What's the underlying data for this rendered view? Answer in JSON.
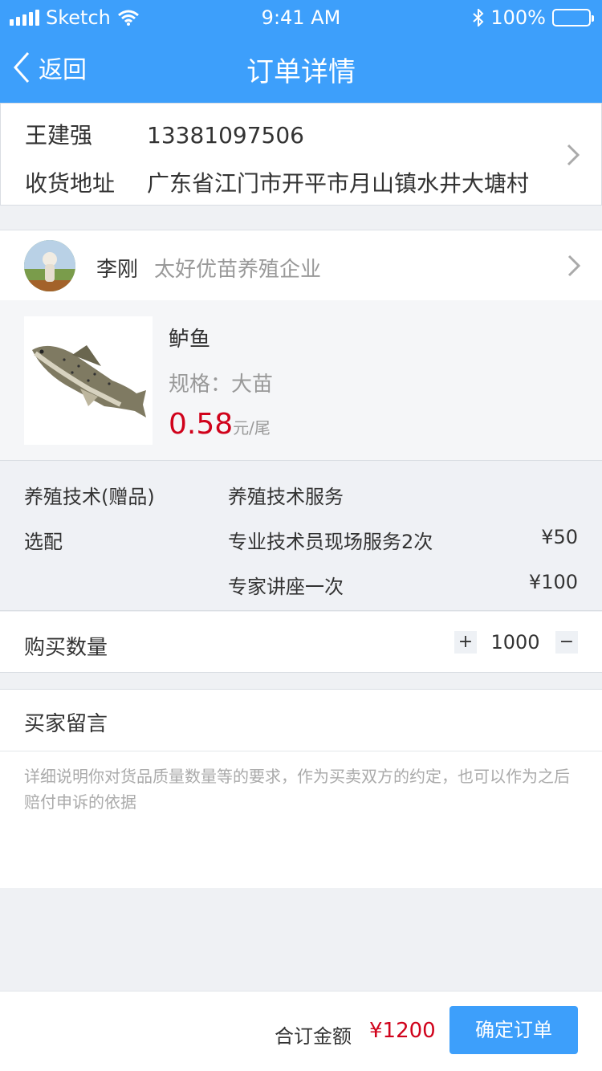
{
  "status_bar": {
    "carrier": "Sketch",
    "time": "9:41 AM",
    "battery": "100%"
  },
  "nav": {
    "back_label": "返回",
    "title": "订单详情"
  },
  "address": {
    "name": "王建强",
    "phone": "13381097506",
    "label": "收货地址",
    "value": "广东省江门市开平市月山镇水井大塘村"
  },
  "seller": {
    "name": "李刚",
    "company": "太好优苗养殖企业"
  },
  "product": {
    "name": "鲈鱼",
    "spec": "规格：大苗",
    "price": "0.58",
    "unit": "元/尾"
  },
  "services": {
    "gift_label": "养殖技术(赠品)",
    "gift_value": "养殖技术服务",
    "optional_label": "选配",
    "options": [
      {
        "name": "专业技术员现场服务2次",
        "price": "¥50"
      },
      {
        "name": "专家讲座一次",
        "price": "¥100"
      }
    ]
  },
  "quantity": {
    "label": "购买数量",
    "plus": "+",
    "value": "1000",
    "minus": "−"
  },
  "message": {
    "label": "买家留言",
    "placeholder": "详细说明你对货品质量数量等的要求，作为买卖双方的约定，也可以作为之后赔付申诉的依据"
  },
  "footer": {
    "total_label": "合订金额",
    "total_value": "¥1200",
    "confirm_label": "确定订单"
  },
  "colors": {
    "primary": "#3d9ffb",
    "price_red": "#d0021b"
  }
}
